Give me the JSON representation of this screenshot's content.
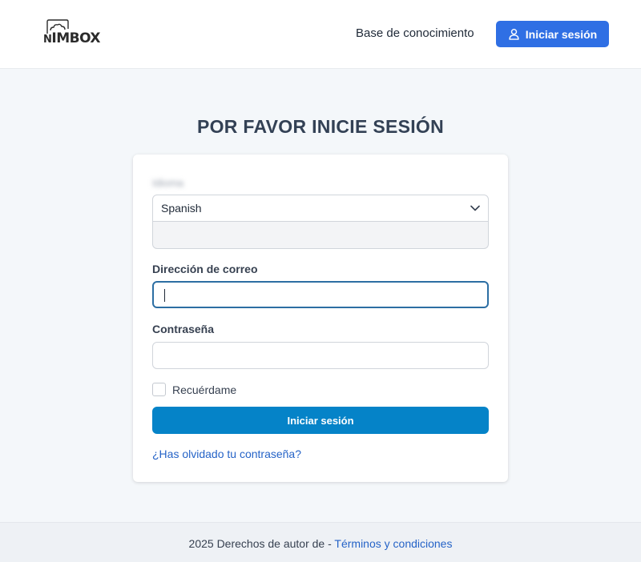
{
  "header": {
    "logo_text_lead": "N",
    "logo_text_rest": "IMBOX",
    "kb_link": "Base de conocimiento",
    "login_button": "Iniciar sesión"
  },
  "page": {
    "title": "POR FAVOR INICIE SESIÓN"
  },
  "form": {
    "language_label": "Idioma",
    "language_selected": "Spanish",
    "email_label": "Dirección de correo",
    "email_value": "",
    "password_label": "Contraseña",
    "password_value": "",
    "remember_label": "Recuérdame",
    "submit_label": "Iniciar sesión",
    "forgot_link": "¿Has olvidado tu contraseña?"
  },
  "footer": {
    "copyright": "2025 Derechos de autor de - ",
    "terms_link": "Términos y condiciones"
  },
  "colors": {
    "primary": "#2f6fe4",
    "submit": "#0583c8",
    "link": "#2563c7"
  },
  "icons": {
    "logo": "cloud-icon",
    "login": "user-icon",
    "select": "chevron-down-icon"
  }
}
